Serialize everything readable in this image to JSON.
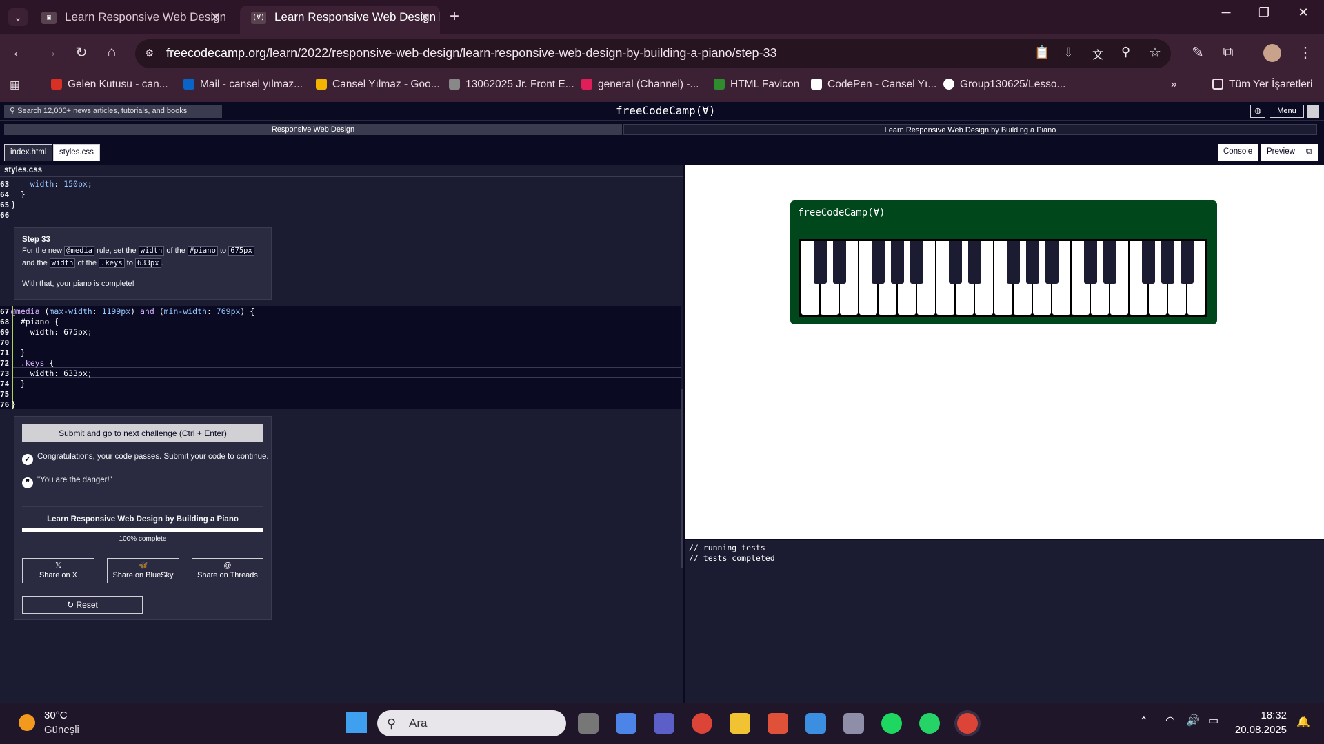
{
  "tabs": [
    {
      "title": "Learn Responsive Web Design b"
    },
    {
      "title": "Learn Responsive Web Design b"
    }
  ],
  "address": {
    "domain": "freecodecamp.org",
    "path": "/learn/2022/responsive-web-design/learn-responsive-web-design-by-building-a-piano/step-33"
  },
  "bookmarks": [
    "Gelen Kutusu - can...",
    "Mail - cansel yılmaz...",
    "Cansel Yılmaz - Goo...",
    "13062025 Jr. Front E...",
    "general (Channel) -...",
    "HTML Favicon",
    "CodePen - Cansel Yı...",
    "Group130625/Lesso...",
    "Tüm Yer İşaretleri"
  ],
  "fcc": {
    "search": "Search 12,000+ news articles, tutorials, and books",
    "logo": "freeCodeCamp(Ɐ)",
    "menu": "Menu",
    "crumb1": "Responsive Web Design",
    "crumb2": "Learn Responsive Web Design by Building a Piano",
    "file1": "index.html",
    "file2": "styles.css",
    "console_btn": "Console",
    "preview_btn": "Preview",
    "filename": "styles.css"
  },
  "step": {
    "title": "Step 33",
    "t1": "For the new",
    "c1": "@media",
    "t2": "rule, set the",
    "c2": "width",
    "t3": "of the",
    "c3": "#piano",
    "t4": "to",
    "c4": "675px",
    "t5": "and the",
    "c5": "width",
    "t6": "of the",
    "c6": ".keys",
    "t7": "to",
    "c7": "633px",
    "t8": ".",
    "done": "With that, your piano is complete!"
  },
  "lower": {
    "submit": "Submit and go to next challenge (Ctrl + Enter)",
    "passed": "Congratulations, your code passes. Submit your code to continue.",
    "quote": "\"You are the danger!\"",
    "course": "Learn Responsive Web Design by Building a Piano",
    "progress_label": "100% complete",
    "progress": 1.0,
    "share_x": "Share on X",
    "share_bluesky": "Share on BlueSky",
    "share_threads": "Share on Threads",
    "reset": "Reset"
  },
  "preview": {
    "logo": "freeCodeCamp(Ɐ)"
  },
  "console": [
    "// running tests",
    "// tests completed"
  ],
  "taskbar": {
    "temp": "30°C",
    "weather": "Güneşli",
    "search": "Ara",
    "time": "18:32",
    "date": "20.08.2025"
  }
}
